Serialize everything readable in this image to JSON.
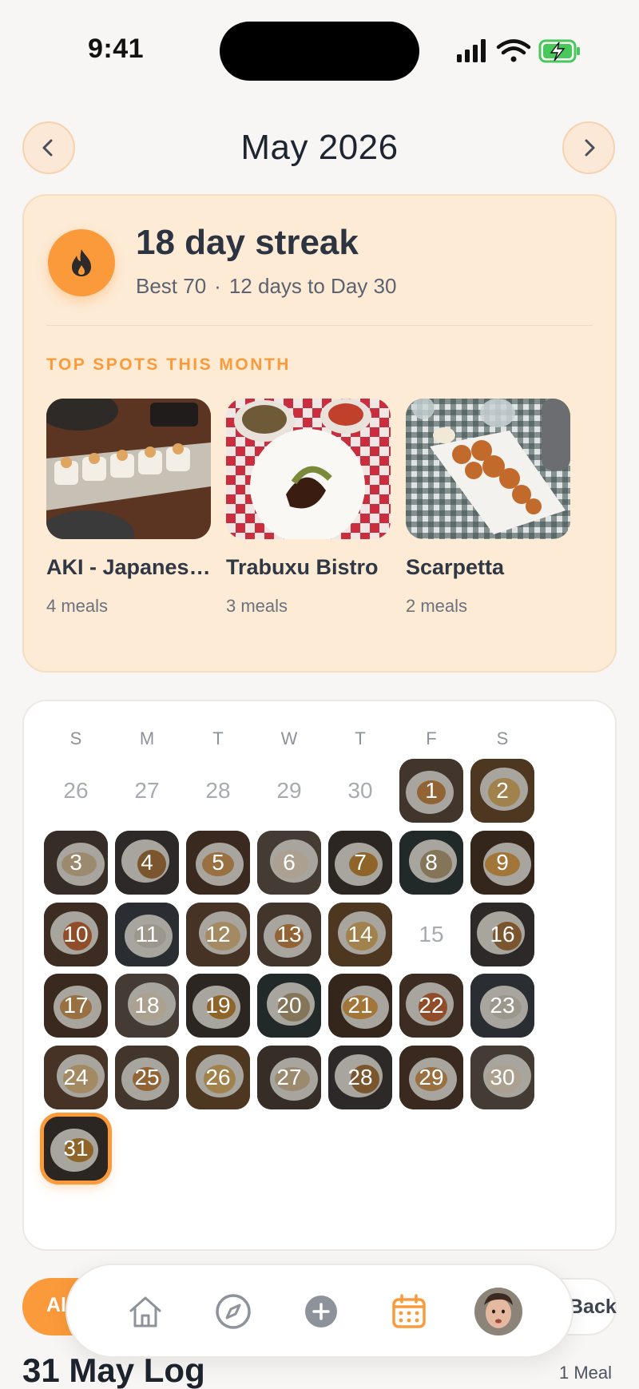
{
  "status_bar": {
    "time": "9:41",
    "icons": [
      "signal-icon",
      "wifi-icon",
      "battery-charging-icon"
    ]
  },
  "header": {
    "month": "May 2026",
    "prev_icon": "chevron-left-icon",
    "next_icon": "chevron-right-icon"
  },
  "streak": {
    "icon": "flame-icon",
    "title": "18 day streak",
    "best": "Best 70",
    "separator": "·",
    "goal": "12 days to Day 30",
    "top_spots_label": "TOP SPOTS THIS MONTH",
    "spots": [
      {
        "name": "AKI - Japanese Restaurant",
        "count": "4 meals"
      },
      {
        "name": "Trabuxu Bistro",
        "count": "3 meals"
      },
      {
        "name": "Scarpetta",
        "count": "2 meals"
      }
    ]
  },
  "calendar": {
    "weekdays": [
      "S",
      "M",
      "T",
      "W",
      "T",
      "F",
      "S"
    ],
    "leading_days": [
      "26",
      "27",
      "28",
      "29",
      "30"
    ],
    "days": [
      "1",
      "2",
      "3",
      "4",
      "5",
      "6",
      "7",
      "8",
      "9",
      "10",
      "11",
      "12",
      "13",
      "14",
      "15",
      "16",
      "17",
      "18",
      "19",
      "20",
      "21",
      "22",
      "23",
      "24",
      "25",
      "26",
      "27",
      "28",
      "29",
      "30",
      "31"
    ],
    "no_photo_days": [
      "15"
    ],
    "selected_day": "31"
  },
  "filters": {
    "left": "All",
    "right": "Back"
  },
  "tab_bar": {
    "items": [
      "home-icon",
      "compass-icon",
      "plus-icon",
      "calendar-icon",
      "avatar"
    ],
    "active": "calendar-icon"
  },
  "log": {
    "title": "31 May Log",
    "count": "1 Meal"
  },
  "colors": {
    "accent": "#fb9a3b",
    "card_bg": "#fdebd6",
    "page_bg": "#f7f6f4"
  }
}
